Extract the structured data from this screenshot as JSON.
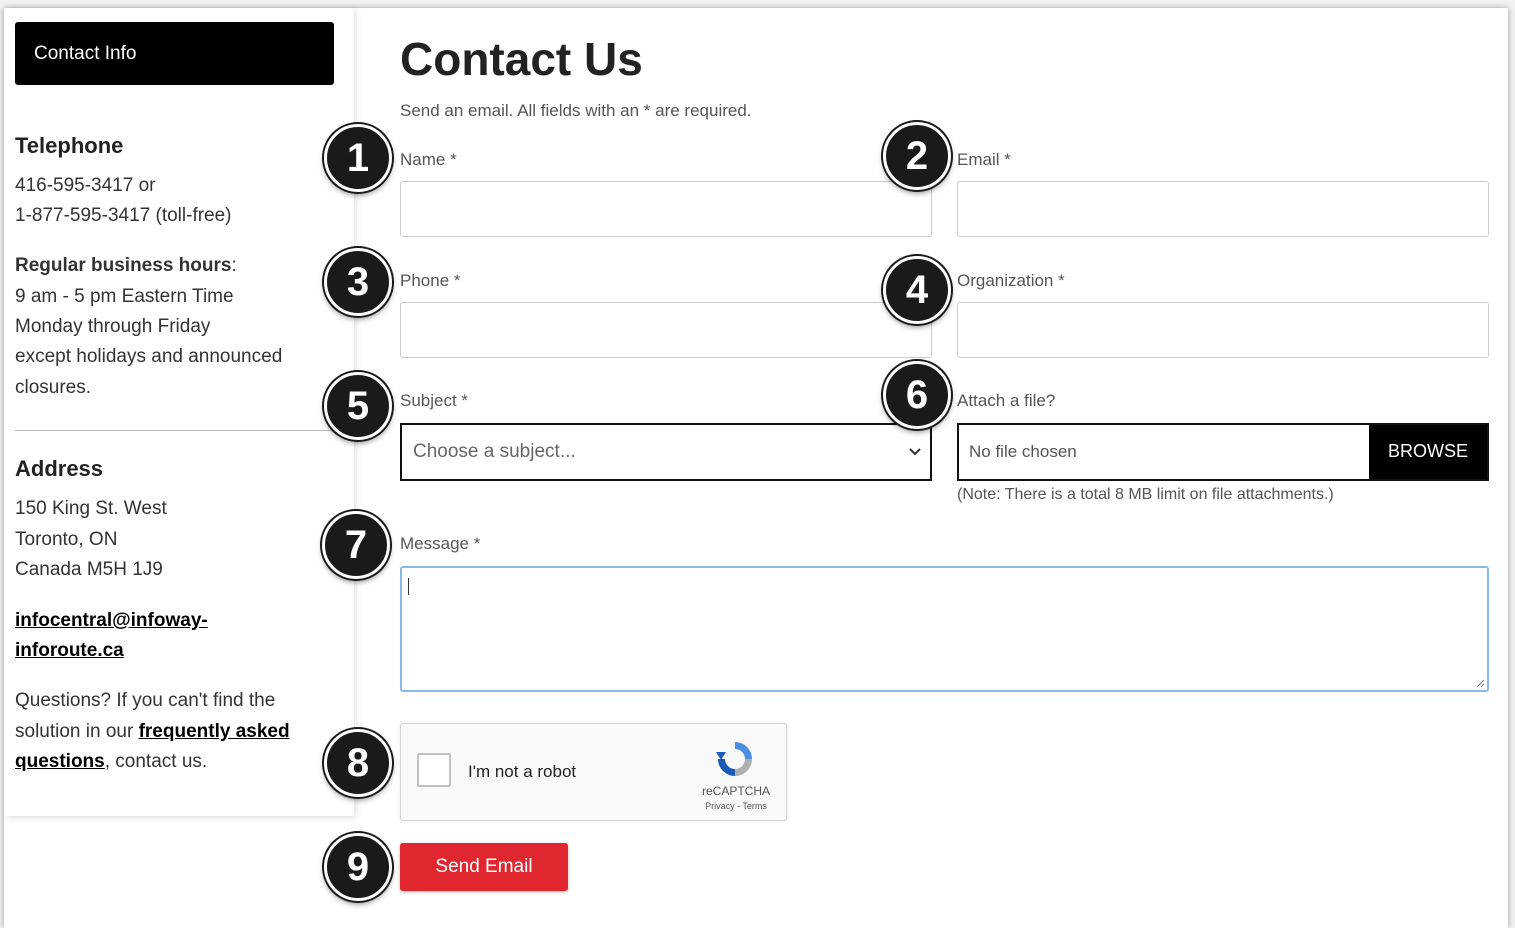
{
  "sidebar": {
    "header": "Contact Info",
    "telephone_heading": "Telephone",
    "phone_local": "416-595-3417 or",
    "phone_tollfree": "1-877-595-3417 (toll-free)",
    "hours_heading": "Regular business hours",
    "hours_colon": ":",
    "hours_lines": [
      "9 am - 5 pm Eastern Time",
      "Monday through Friday",
      "except holidays and announced",
      "closures."
    ],
    "address_heading": "Address",
    "address_lines": [
      "150 King St. West",
      "Toronto, ON",
      "Canada M5H 1J9"
    ],
    "email_line1": "infocentral@infoway-",
    "email_line2": "inforoute.ca",
    "questions_line1": "Questions? If you can't find the",
    "questions_line2_pre": "solution in our ",
    "faq_line1": "frequently asked",
    "faq_line2": "questions",
    "questions_line3_post": ", contact us."
  },
  "form": {
    "title": "Contact Us",
    "subtitle": "Send an email. All fields with an * are required.",
    "name_label": "Name *",
    "email_label": "Email *",
    "phone_label": "Phone *",
    "organization_label": "Organization *",
    "subject_label": "Subject *",
    "subject_value": "Choose a subject...",
    "attach_label": "Attach a file?",
    "file_status": "No file chosen",
    "browse_label": "BROWSE",
    "attach_note": "(Note: There is a total 8 MB limit on file attachments.)",
    "message_label": "Message *",
    "captcha_text": "I'm not a robot",
    "captcha_brand": "reCAPTCHA",
    "captcha_terms": "Privacy - Terms",
    "submit_label": "Send Email"
  },
  "badges": [
    "1",
    "2",
    "3",
    "4",
    "5",
    "6",
    "7",
    "8",
    "9"
  ],
  "colors": {
    "submit": "#e0262e",
    "header_bg": "#000000",
    "badge_bg": "#1a1a1a",
    "focus_border": "#8bb8e8"
  }
}
